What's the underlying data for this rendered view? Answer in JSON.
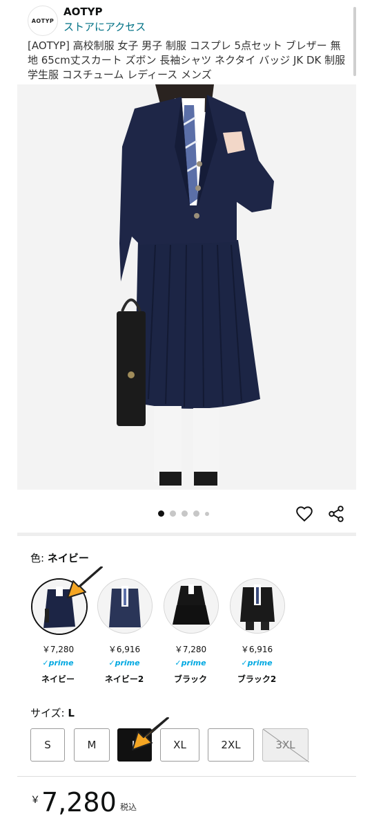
{
  "header": {
    "logo_text": "AOTYP",
    "store_name": "AOTYP",
    "store_link": "ストアにアクセス"
  },
  "product": {
    "title": "[AOTYP] 高校制服 女子 男子 制服 コスプレ 5点セット ブレザー 無地 65cm丈スカート ズボン 長袖シャツ ネクタイ バッジ JK DK 制服 学生服 コスチューム レディース メンズ"
  },
  "color": {
    "label": "色:",
    "selected": "ネイビー",
    "options": [
      {
        "price": "￥7,280",
        "prime": "✓prime",
        "name": "ネイビー"
      },
      {
        "price": "￥6,916",
        "prime": "✓prime",
        "name": "ネイビー2"
      },
      {
        "price": "￥7,280",
        "prime": "✓prime",
        "name": "ブラック"
      },
      {
        "price": "￥6,916",
        "prime": "✓prime",
        "name": "ブラック2"
      }
    ]
  },
  "size": {
    "label": "サイズ:",
    "selected": "L",
    "options": [
      "S",
      "M",
      "L",
      "XL",
      "2XL",
      "3XL"
    ]
  },
  "price": {
    "currency": "￥",
    "amount": "7,280",
    "tax_note": "税込"
  },
  "carousel": {
    "total_dots": 5,
    "active_index": 0
  },
  "colors": {
    "navy": "#1c2545",
    "prime_blue": "#00a8e1",
    "link": "#007185",
    "arrow": "#f5a623"
  }
}
